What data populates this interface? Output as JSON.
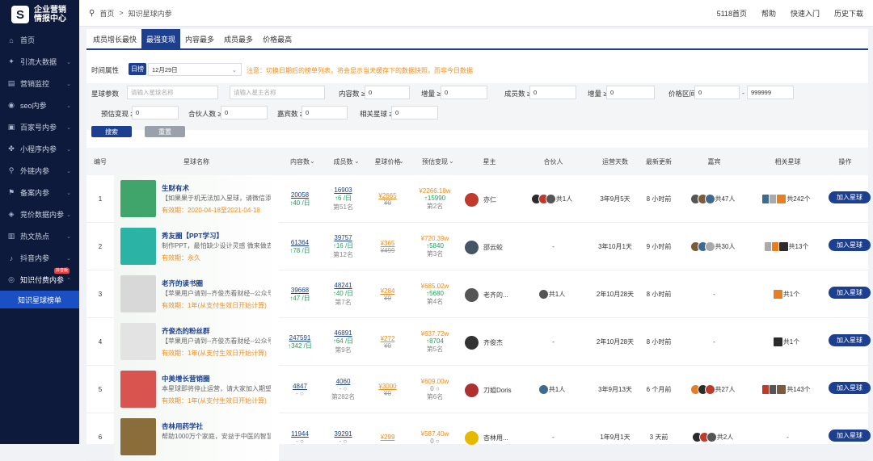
{
  "logo": {
    "line1": "企业营销",
    "line2": "情报中心"
  },
  "sidebar": {
    "items": [
      {
        "label": "首页",
        "icon": "home-icon",
        "glyph": "⌂",
        "chev": false
      },
      {
        "label": "引流大数据",
        "icon": "flow-icon",
        "glyph": "✦",
        "chev": true
      },
      {
        "label": "营销监控",
        "icon": "monitor-icon",
        "glyph": "▤",
        "chev": true
      },
      {
        "label": "seo内参",
        "icon": "seo-icon",
        "glyph": "◉",
        "chev": true
      },
      {
        "label": "百家号内参",
        "icon": "bjh-icon",
        "glyph": "▣",
        "chev": true
      },
      {
        "label": "小程序内参",
        "icon": "miniapp-icon",
        "glyph": "✤",
        "chev": true
      },
      {
        "label": "外链内参",
        "icon": "link-icon",
        "glyph": "⚲",
        "chev": true
      },
      {
        "label": "备案内参",
        "icon": "record-icon",
        "glyph": "⚑",
        "chev": true
      },
      {
        "label": "竞价数据内参",
        "icon": "bid-icon",
        "glyph": "◈",
        "chev": true
      },
      {
        "label": "热文热点",
        "icon": "hot-icon",
        "glyph": "▥",
        "chev": true
      },
      {
        "label": "抖音内参",
        "icon": "douyin-icon",
        "glyph": "♪",
        "chev": true
      },
      {
        "label": "知识付费内参",
        "icon": "knowledge-icon",
        "glyph": "◎",
        "chev": true,
        "open": true,
        "badge": "抖音版"
      }
    ],
    "sub": "知识星球榜单"
  },
  "breadcrumb": {
    "home": "首页",
    "sep": ">",
    "current": "知识星球内参"
  },
  "topnav": [
    "5118首页",
    "帮助",
    "快速入门",
    "历史下载"
  ],
  "tabs": [
    "成员增长最快",
    "最强变现",
    "内容最多",
    "成员最多",
    "价格最高"
  ],
  "filters": {
    "time_label": "时间属性",
    "time_type": "日榜",
    "date": "12月29日",
    "notice": "注意：切换日期后的榜单列表，将会显示当天缓存下的数据快照，而非今日数据",
    "planet_label": "星球参数",
    "planet_name_ph": "请输入星球名称",
    "owner_name_ph": "请输入星主名称",
    "content_label": "内容数 ≥",
    "content_val": "0",
    "inc_label": "增量 ≥",
    "inc_val": "0",
    "member_label": "成员数 ≥",
    "member_val": "0",
    "inc2_label": "增量 ≥",
    "inc2_val": "0",
    "price_label": "价格区间",
    "price_min": "0",
    "price_dash": "-",
    "price_max": "999999",
    "est_label": "预估变现 ≥",
    "est_val": "0",
    "partner_label": "合伙人数 ≥",
    "partner_val": "0",
    "guest_label": "嘉宾数 ≥",
    "guest_val": "0",
    "related_label": "相关星球 ≥",
    "related_val": "0",
    "search": "搜索",
    "reset": "重置"
  },
  "table": {
    "headers": [
      "编号",
      "星球名称",
      "内容数",
      "成员数",
      "星球价格",
      "预估变现",
      "星主",
      "合伙人",
      "运营天数",
      "最新更新",
      "嘉宾",
      "相关星球",
      "操作"
    ],
    "rows": [
      {
        "no": "1",
        "name": "生财有术",
        "desc": "【如果果于机无法加入星球，请微信添...",
        "valid": "有效期：2020-04-18至2021-04-18",
        "content": "20058",
        "content_inc": "↑40 /日",
        "members": "16903",
        "members_inc": "↑6 /日",
        "rank": "第51名",
        "price": "¥2665",
        "orig": "¥0",
        "est": "¥2266.18w",
        "est_inc": "↑15990",
        "est_rank": "第2名",
        "owner": "亦仁",
        "partner": "共1人",
        "days": "3年9月5天",
        "update": "8 小时前",
        "guests": "共47人",
        "related": "共242个",
        "action": "加入星球",
        "thumb": "#3fa56b",
        "oav": "#c0392b"
      },
      {
        "no": "2",
        "name": "秀友圈【PPT学习】",
        "desc": "制作PPT，最怕缺少设计灵感 微来做去...",
        "valid": "有效期：永久",
        "content": "61364",
        "content_inc": "↑78 /日",
        "members": "39757",
        "members_inc": "↑16 /日",
        "rank": "第12名",
        "price": "¥365",
        "orig": "¥499",
        "est": "¥720.39w",
        "est_inc": "↑5840",
        "est_rank": "第3名",
        "owner": "邵云蛟",
        "partner": "-",
        "days": "3年10月1天",
        "update": "9 小时前",
        "guests": "共30人",
        "related": "共13个",
        "action": "加入星球",
        "thumb": "#2bb3a5",
        "oav": "#445566"
      },
      {
        "no": "3",
        "name": "老齐的读书圈",
        "desc": "【苹果用户请到--齐俊杰看财经--公众号...",
        "valid": "有效期：1年(从支付生效日开始计算)",
        "content": "39668",
        "content_inc": "↑47 /日",
        "members": "48241",
        "members_inc": "↑40 /日",
        "rank": "第7名",
        "price": "¥284",
        "orig": "¥0",
        "est": "¥685.02w",
        "est_inc": "↑5680",
        "est_rank": "第4名",
        "owner": "老齐的...",
        "partner": "共1人",
        "days": "2年10月28天",
        "update": "8 小时前",
        "guests": "-",
        "related": "共1个",
        "action": "加入星球",
        "thumb": "#d8d8d8",
        "oav": "#555"
      },
      {
        "no": "4",
        "name": "齐俊杰的粉丝群",
        "desc": "【苹果用户请到--齐俊杰看财经--公众号...",
        "valid": "有效期：1年(从支付生效日开始计算)",
        "content": "247591",
        "content_inc": "↑342 /日",
        "members": "46891",
        "members_inc": "↑64 /日",
        "rank": "第9名",
        "price": "¥272",
        "orig": "¥0",
        "est": "¥637.72w",
        "est_inc": "↑8704",
        "est_rank": "第5名",
        "owner": "齐俊杰",
        "partner": "-",
        "days": "2年10月28天",
        "update": "8 小时前",
        "guests": "-",
        "related": "共1个",
        "action": "加入星球",
        "thumb": "#e3e3e3",
        "oav": "#333"
      },
      {
        "no": "5",
        "name": "中美增长营销圈",
        "desc": "本星球即将停止运营，请大家加入期望...",
        "valid": "有效期：1年(从支付生效日开始计算)",
        "content": "4847",
        "content_inc": "- ○",
        "members": "4060",
        "members_inc": "- ○",
        "rank": "第282名",
        "price": "¥3000",
        "orig": "¥0",
        "est": "¥609.00w",
        "est_inc": "0 ○",
        "est_rank": "第6名",
        "owner": "刀姐Doris",
        "partner": "共1人",
        "days": "3年9月13天",
        "update": "6 个月前",
        "guests": "共27人",
        "related": "共143个",
        "action": "加入星球",
        "thumb": "#d9534f",
        "oav": "#b03030"
      },
      {
        "no": "6",
        "name": "杏林用药学社",
        "desc": "帮助1000万个家庭，安益于中医的智慧...",
        "valid": "",
        "content": "11944",
        "content_inc": "- ○",
        "members": "39291",
        "members_inc": "- ○",
        "rank": "",
        "price": "¥299",
        "orig": "",
        "est": "¥587.40w",
        "est_inc": "0 ○",
        "est_rank": "",
        "owner": "杏林用...",
        "partner": "-",
        "days": "1年9月1天",
        "update": "3 天前",
        "guests": "共2人",
        "related": "-",
        "action": "加入星球",
        "thumb": "#8a6d3b",
        "oav": "#e6b800"
      }
    ]
  }
}
